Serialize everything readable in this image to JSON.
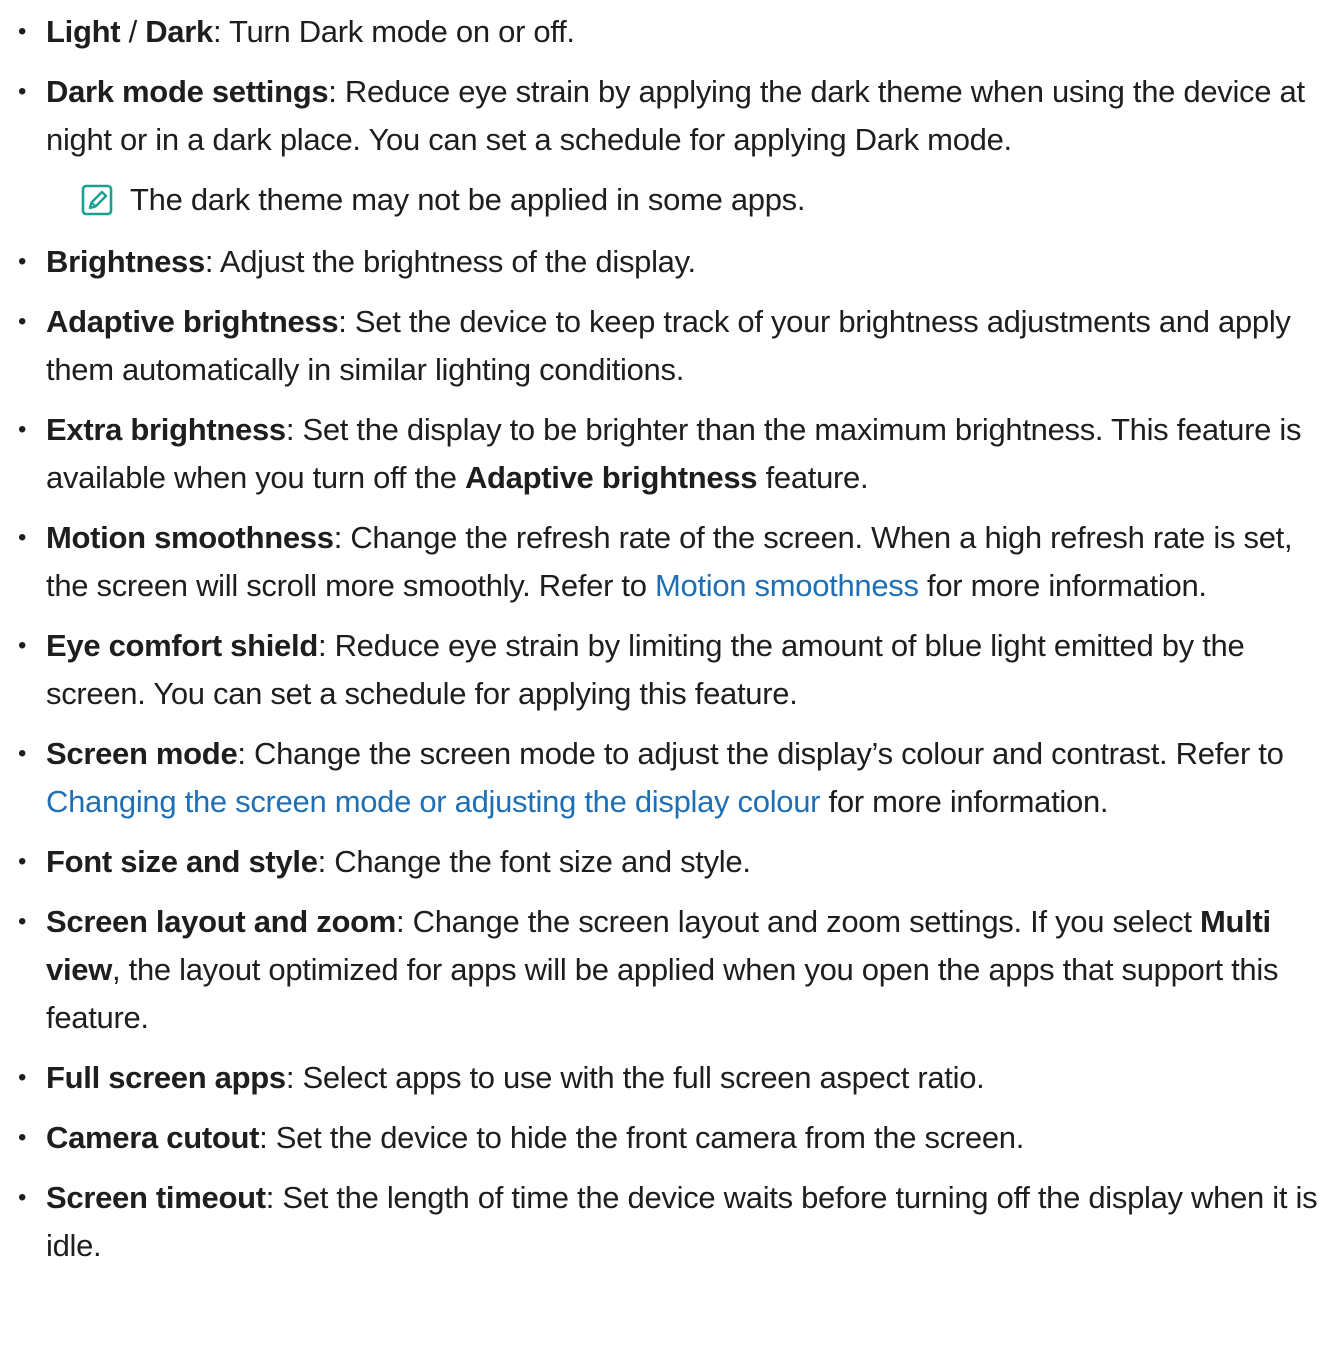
{
  "items": [
    {
      "parts": [
        {
          "t": "Light",
          "b": true
        },
        {
          "t": " / "
        },
        {
          "t": "Dark",
          "b": true
        },
        {
          "t": ": Turn Dark mode on or off."
        }
      ]
    },
    {
      "parts": [
        {
          "t": "Dark mode settings",
          "b": true
        },
        {
          "t": ": Reduce eye strain by applying the dark theme when using the device at night or in a dark place. You can set a schedule for applying Dark mode."
        }
      ],
      "note": "The dark theme may not be applied in some apps."
    },
    {
      "parts": [
        {
          "t": "Brightness",
          "b": true
        },
        {
          "t": ": Adjust the brightness of the display."
        }
      ]
    },
    {
      "parts": [
        {
          "t": "Adaptive brightness",
          "b": true
        },
        {
          "t": ": Set the device to keep track of your brightness adjustments and apply them automatically in similar lighting conditions."
        }
      ]
    },
    {
      "parts": [
        {
          "t": "Extra brightness",
          "b": true
        },
        {
          "t": ": Set the display to be brighter than the maximum brightness. This feature is available when you turn off the "
        },
        {
          "t": "Adaptive brightness",
          "b": true
        },
        {
          "t": " feature."
        }
      ]
    },
    {
      "parts": [
        {
          "t": "Motion smoothness",
          "b": true
        },
        {
          "t": ": Change the refresh rate of the screen. When a high refresh rate is set, the screen will scroll more smoothly. Refer to "
        },
        {
          "t": "Motion smoothness",
          "link": true
        },
        {
          "t": " for more information."
        }
      ]
    },
    {
      "parts": [
        {
          "t": "Eye comfort shield",
          "b": true
        },
        {
          "t": ": Reduce eye strain by limiting the amount of blue light emitted by the screen. You can set a schedule for applying this feature."
        }
      ]
    },
    {
      "parts": [
        {
          "t": "Screen mode",
          "b": true
        },
        {
          "t": ": Change the screen mode to adjust the display’s colour and contrast. Refer to "
        },
        {
          "t": "Changing the screen mode or adjusting the display colour",
          "link": true
        },
        {
          "t": " for more information."
        }
      ]
    },
    {
      "parts": [
        {
          "t": "Font size and style",
          "b": true
        },
        {
          "t": ": Change the font size and style."
        }
      ]
    },
    {
      "parts": [
        {
          "t": "Screen layout and zoom",
          "b": true
        },
        {
          "t": ": Change the screen layout and zoom settings. If you select "
        },
        {
          "t": "Multi view",
          "b": true
        },
        {
          "t": ", the layout optimized for apps will be applied when you open the apps that support this feature."
        }
      ]
    },
    {
      "parts": [
        {
          "t": "Full screen apps",
          "b": true
        },
        {
          "t": ": Select apps to use with the full screen aspect ratio."
        }
      ]
    },
    {
      "parts": [
        {
          "t": "Camera cutout",
          "b": true
        },
        {
          "t": ": Set the device to hide the front camera from the screen."
        }
      ]
    },
    {
      "parts": [
        {
          "t": "Screen timeout",
          "b": true
        },
        {
          "t": ": Set the length of time the device waits before turning off the display when it is idle."
        }
      ]
    }
  ],
  "note_icon": "note-pencil-icon",
  "colors": {
    "text": "#1e1e1e",
    "link": "#1f6fb5",
    "icon": "#1aa090"
  }
}
